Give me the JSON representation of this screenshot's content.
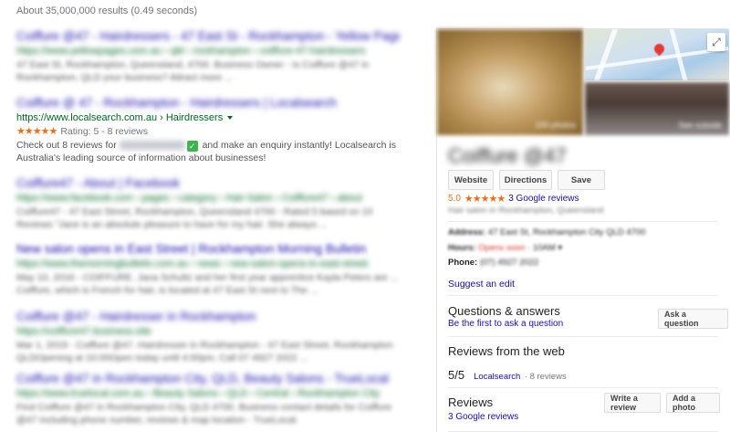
{
  "stats": "About 35,000,000 results (0.49 seconds)",
  "results": [
    {
      "title": "Coiffure @47 - Hairdressers - 47 East St - Rockhampton - Yellow Pages",
      "url": "https://www.yellowpages.com.au › qld › rockhampton › coiffure-47-hairdressers",
      "snippet": "47 East St, Rockhampton, Queensland, 4700. Business Owner - Is Coiffure @47 in Rockhampton, QLD your business? Attract more ..."
    },
    {
      "title": "Coiffure @ 47 - Rockhampton - Hairdressers | Localsearch",
      "url": "https://www.localsearch.com.au › Hairdressers",
      "rating_text": "Rating: 5 - 8 reviews",
      "snippet_before": "Check out 8 reviews for",
      "snippet_after": "and make an enquiry instantly! Localsearch is Australia's leading source of information about businesses!",
      "check_glyph": "✓"
    },
    {
      "title": "Coiffure47 - About | Facebook",
      "url": "https://www.facebook.com › pages › category › Hair-Salon › Coiffure47 › about",
      "snippet": "Coiffure47 - 47 East Street, Rockhampton, Queensland 4700 - Rated 5 based on 10 Reviews \"Jane is an absolute pleasure to have for my hair. She always ..."
    },
    {
      "title": "New salon opens in East Street | Rockhampton Morning Bulletin",
      "url": "https://www.themorningbulletin.com.au › news › new-salon-opens-in-east-street",
      "snippet": "May 10, 2016 - COIFFURE. Jana Schultz and her first year apprentice Kayla Peters are ... Coiffure, which is French for hair, is located at 47 East St next to The ..."
    },
    {
      "title": "Coiffure @47 - Hairdresser in Rockhampton",
      "url": "https://coiffure47.business.site",
      "snippet": "Mar 1, 2019 - Coiffure @47. Hairdresser in Rockhampton - 47 East Street, Rockhampton QLDOpening at 10:00Open today until 4:00pm. Call 07 4927 2022 ..."
    },
    {
      "title": "Coiffure @47 in Rockhampton City, QLD, Beauty Salons - TrueLocal",
      "url": "https://www.truelocal.com.au › Beauty Salons › QLD › Central › Rockhampton City",
      "snippet": "Find Coiffure @47 in Rockhampton City, QLD 4700. Business contact details for Coiffure @47 including phone number, reviews & map location - TrueLocal."
    }
  ],
  "panel": {
    "photo_caption": "100 photos",
    "street_caption": "See outside",
    "expand_glyph": "⤢",
    "name": "Coiffure @47",
    "actions": {
      "website": "Website",
      "directions": "Directions",
      "save": "Save"
    },
    "rating": "5.0",
    "stars": "★★★★★",
    "reviews_link": "3 Google reviews",
    "category": "Hair salon in Rockhampton, Queensland",
    "address_label": "Address:",
    "address_value": "47 East St, Rockhampton City QLD 4700",
    "hours_label": "Hours:",
    "hours_open": "Opens soon",
    "hours_time": "· 10AM ▾",
    "phone_label": "Phone:",
    "phone_value": "(07) 4927 2022",
    "suggest_edit": "Suggest an edit",
    "qa_title": "Questions & answers",
    "qa_link": "Be the first to ask a question",
    "qa_button": "Ask a question",
    "web_reviews_title": "Reviews from the web",
    "web_score": "5/5",
    "web_source": "Localsearch",
    "web_count": "· 8 reviews",
    "reviews_title": "Reviews",
    "reviews_link2": "3 Google reviews",
    "write_review": "Write a review",
    "add_photo": "Add a photo"
  }
}
